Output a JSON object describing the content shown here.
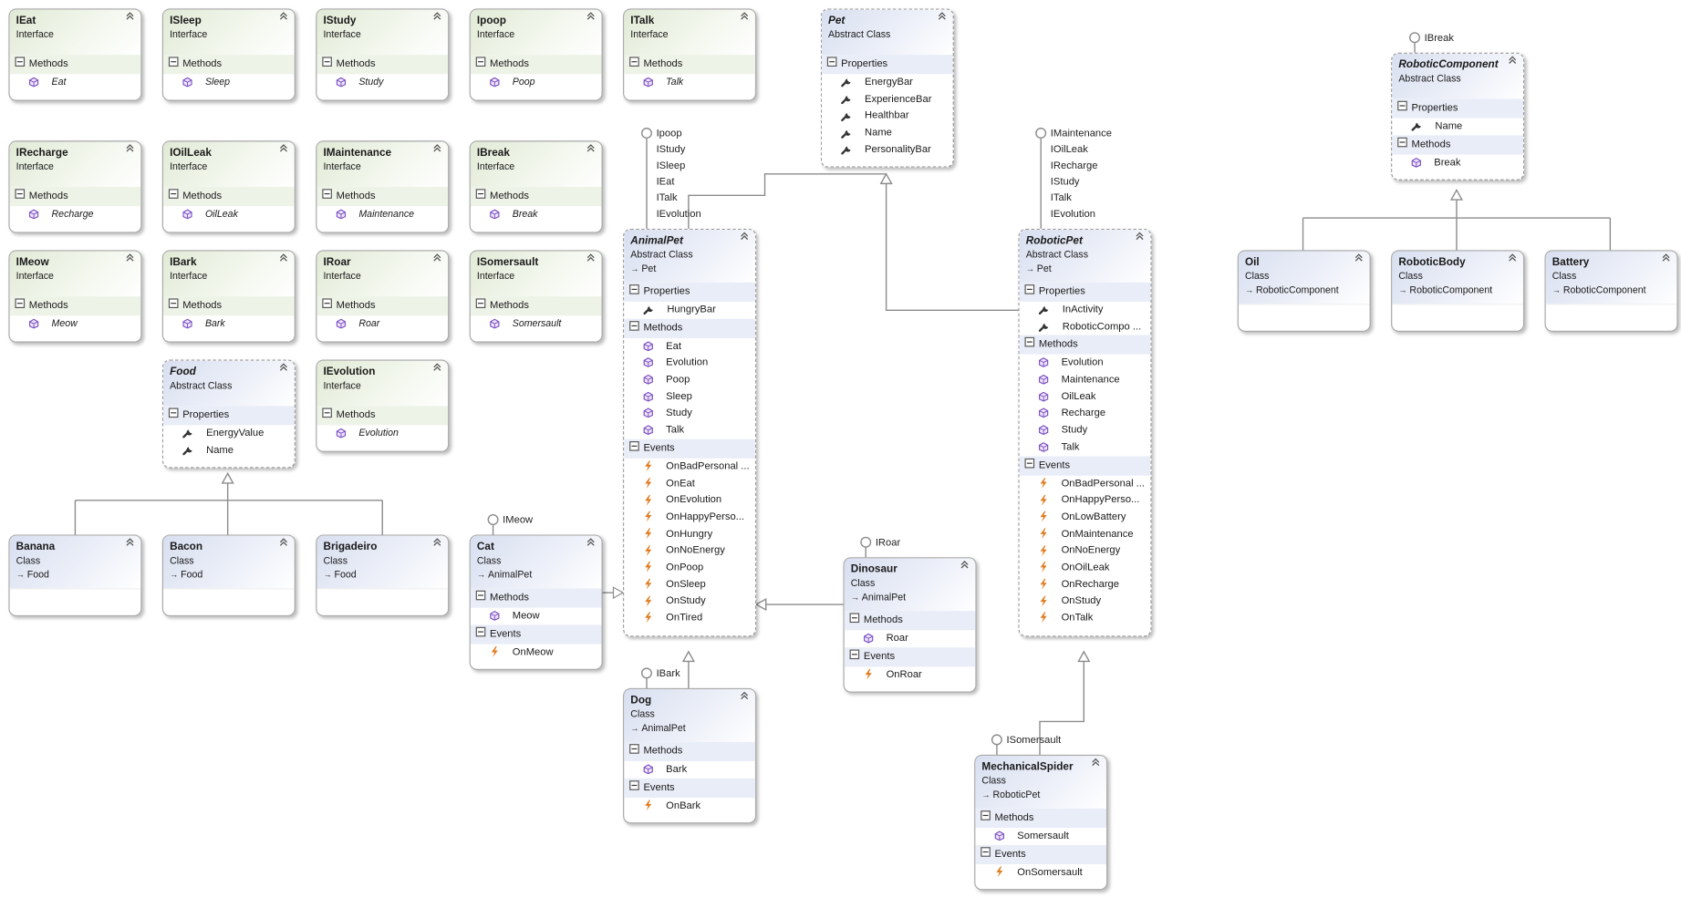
{
  "colors": {
    "interface_header": "#e1ead6",
    "class_header": "#d8dff0",
    "method_icon": "#7b4fc2",
    "event_icon": "#e07b20",
    "connector": "#8c8c8c"
  },
  "icons": {
    "collapse": "double-chevron-up-icon",
    "section_toggle": "minus-box-icon",
    "method": "method-cube-icon",
    "property": "wrench-icon",
    "event": "lightning-icon",
    "lollipop": "interface-lollipop-icon",
    "inheritance": "hollow-triangle-arrow-icon"
  },
  "boxes": [
    {
      "id": "IEat",
      "name": "IEat",
      "kind": "Interface",
      "sections": [
        {
          "label": "Methods",
          "items": [
            {
              "name": "Eat",
              "icon": "method"
            }
          ]
        }
      ]
    },
    {
      "id": "ISleep",
      "name": "ISleep",
      "kind": "Interface",
      "sections": [
        {
          "label": "Methods",
          "items": [
            {
              "name": "Sleep",
              "icon": "method"
            }
          ]
        }
      ]
    },
    {
      "id": "IStudy",
      "name": "IStudy",
      "kind": "Interface",
      "sections": [
        {
          "label": "Methods",
          "items": [
            {
              "name": "Study",
              "icon": "method"
            }
          ]
        }
      ]
    },
    {
      "id": "Ipoop",
      "name": "Ipoop",
      "kind": "Interface",
      "sections": [
        {
          "label": "Methods",
          "items": [
            {
              "name": "Poop",
              "icon": "method"
            }
          ]
        }
      ]
    },
    {
      "id": "ITalk",
      "name": "ITalk",
      "kind": "Interface",
      "sections": [
        {
          "label": "Methods",
          "items": [
            {
              "name": "Talk",
              "icon": "method"
            }
          ]
        }
      ]
    },
    {
      "id": "IRecharge",
      "name": "IRecharge",
      "kind": "Interface",
      "sections": [
        {
          "label": "Methods",
          "items": [
            {
              "name": "Recharge",
              "icon": "method"
            }
          ]
        }
      ]
    },
    {
      "id": "IOilLeak",
      "name": "IOilLeak",
      "kind": "Interface",
      "sections": [
        {
          "label": "Methods",
          "items": [
            {
              "name": "OilLeak",
              "icon": "method"
            }
          ]
        }
      ]
    },
    {
      "id": "IMaintenance",
      "name": "IMaintenance",
      "kind": "Interface",
      "sections": [
        {
          "label": "Methods",
          "items": [
            {
              "name": "Maintenance",
              "icon": "method"
            }
          ]
        }
      ]
    },
    {
      "id": "IBreak",
      "name": "IBreak",
      "kind": "Interface",
      "sections": [
        {
          "label": "Methods",
          "items": [
            {
              "name": "Break",
              "icon": "method"
            }
          ]
        }
      ]
    },
    {
      "id": "IMeow",
      "name": "IMeow",
      "kind": "Interface",
      "sections": [
        {
          "label": "Methods",
          "items": [
            {
              "name": "Meow",
              "icon": "method"
            }
          ]
        }
      ]
    },
    {
      "id": "IBark",
      "name": "IBark",
      "kind": "Interface",
      "sections": [
        {
          "label": "Methods",
          "items": [
            {
              "name": "Bark",
              "icon": "method"
            }
          ]
        }
      ]
    },
    {
      "id": "IRoar",
      "name": "IRoar",
      "kind": "Interface",
      "sections": [
        {
          "label": "Methods",
          "items": [
            {
              "name": "Roar",
              "icon": "method"
            }
          ]
        }
      ]
    },
    {
      "id": "ISomersault",
      "name": "ISomersault",
      "kind": "Interface",
      "sections": [
        {
          "label": "Methods",
          "items": [
            {
              "name": "Somersault",
              "icon": "method"
            }
          ]
        }
      ]
    },
    {
      "id": "IEvolution",
      "name": "IEvolution",
      "kind": "Interface",
      "sections": [
        {
          "label": "Methods",
          "items": [
            {
              "name": "Evolution",
              "icon": "method"
            }
          ]
        }
      ]
    },
    {
      "id": "Food",
      "name": "Food",
      "kind": "Abstract Class",
      "abstract": true,
      "sections": [
        {
          "label": "Properties",
          "items": [
            {
              "name": "EnergyValue",
              "icon": "property"
            },
            {
              "name": "Name",
              "icon": "property"
            }
          ]
        }
      ]
    },
    {
      "id": "Banana",
      "name": "Banana",
      "kind": "Class",
      "base": "Food",
      "sections": []
    },
    {
      "id": "Bacon",
      "name": "Bacon",
      "kind": "Class",
      "base": "Food",
      "sections": []
    },
    {
      "id": "Brigadeiro",
      "name": "Brigadeiro",
      "kind": "Class",
      "base": "Food",
      "sections": []
    },
    {
      "id": "Pet",
      "name": "Pet",
      "kind": "Abstract Class",
      "abstract": true,
      "sections": [
        {
          "label": "Properties",
          "items": [
            {
              "name": "EnergyBar",
              "icon": "property"
            },
            {
              "name": "ExperienceBar",
              "icon": "property"
            },
            {
              "name": "Healthbar",
              "icon": "property"
            },
            {
              "name": "Name",
              "icon": "property"
            },
            {
              "name": "PersonalityBar",
              "icon": "property"
            }
          ]
        }
      ]
    },
    {
      "id": "AnimalPet",
      "name": "AnimalPet",
      "kind": "Abstract Class",
      "abstract": true,
      "base": "Pet",
      "sections": [
        {
          "label": "Properties",
          "items": [
            {
              "name": "HungryBar",
              "icon": "property"
            }
          ]
        },
        {
          "label": "Methods",
          "items": [
            {
              "name": "Eat",
              "icon": "method"
            },
            {
              "name": "Evolution",
              "icon": "method"
            },
            {
              "name": "Poop",
              "icon": "method"
            },
            {
              "name": "Sleep",
              "icon": "method"
            },
            {
              "name": "Study",
              "icon": "method"
            },
            {
              "name": "Talk",
              "icon": "method"
            }
          ]
        },
        {
          "label": "Events",
          "items": [
            {
              "name": "OnBadPersonal ...",
              "icon": "event"
            },
            {
              "name": "OnEat",
              "icon": "event"
            },
            {
              "name": "OnEvolution",
              "icon": "event"
            },
            {
              "name": "OnHappyPerso...",
              "icon": "event"
            },
            {
              "name": "OnHungry",
              "icon": "event"
            },
            {
              "name": "OnNoEnergy",
              "icon": "event"
            },
            {
              "name": "OnPoop",
              "icon": "event"
            },
            {
              "name": "OnSleep",
              "icon": "event"
            },
            {
              "name": "OnStudy",
              "icon": "event"
            },
            {
              "name": "OnTired",
              "icon": "event"
            }
          ]
        }
      ]
    },
    {
      "id": "Cat",
      "name": "Cat",
      "kind": "Class",
      "base": "AnimalPet",
      "sections": [
        {
          "label": "Methods",
          "items": [
            {
              "name": "Meow",
              "icon": "method"
            }
          ]
        },
        {
          "label": "Events",
          "items": [
            {
              "name": "OnMeow",
              "icon": "event"
            }
          ]
        }
      ]
    },
    {
      "id": "Dog",
      "name": "Dog",
      "kind": "Class",
      "base": "AnimalPet",
      "sections": [
        {
          "label": "Methods",
          "items": [
            {
              "name": "Bark",
              "icon": "method"
            }
          ]
        },
        {
          "label": "Events",
          "items": [
            {
              "name": "OnBark",
              "icon": "event"
            }
          ]
        }
      ]
    },
    {
      "id": "Dinosaur",
      "name": "Dinosaur",
      "kind": "Class",
      "base": "AnimalPet",
      "sections": [
        {
          "label": "Methods",
          "items": [
            {
              "name": "Roar",
              "icon": "method"
            }
          ]
        },
        {
          "label": "Events",
          "items": [
            {
              "name": "OnRoar",
              "icon": "event"
            }
          ]
        }
      ]
    },
    {
      "id": "RoboticPet",
      "name": "RoboticPet",
      "kind": "Abstract Class",
      "abstract": true,
      "base": "Pet",
      "sections": [
        {
          "label": "Properties",
          "items": [
            {
              "name": "InActivity",
              "icon": "property"
            },
            {
              "name": "RoboticCompo ...",
              "icon": "property"
            }
          ]
        },
        {
          "label": "Methods",
          "items": [
            {
              "name": "Evolution",
              "icon": "method"
            },
            {
              "name": "Maintenance",
              "icon": "method"
            },
            {
              "name": "OilLeak",
              "icon": "method"
            },
            {
              "name": "Recharge",
              "icon": "method"
            },
            {
              "name": "Study",
              "icon": "method"
            },
            {
              "name": "Talk",
              "icon": "method"
            }
          ]
        },
        {
          "label": "Events",
          "items": [
            {
              "name": "OnBadPersonal ...",
              "icon": "event"
            },
            {
              "name": "OnHappyPerso...",
              "icon": "event"
            },
            {
              "name": "OnLowBattery",
              "icon": "event"
            },
            {
              "name": "OnMaintenance",
              "icon": "event"
            },
            {
              "name": "OnNoEnergy",
              "icon": "event"
            },
            {
              "name": "OnOilLeak",
              "icon": "event"
            },
            {
              "name": "OnRecharge",
              "icon": "event"
            },
            {
              "name": "OnStudy",
              "icon": "event"
            },
            {
              "name": "OnTalk",
              "icon": "event"
            }
          ]
        }
      ]
    },
    {
      "id": "MechanicalSpider",
      "name": "MechanicalSpider",
      "kind": "Class",
      "base": "RoboticPet",
      "sections": [
        {
          "label": "Methods",
          "items": [
            {
              "name": "Somersault",
              "icon": "method"
            }
          ]
        },
        {
          "label": "Events",
          "items": [
            {
              "name": "OnSomersault",
              "icon": "event"
            }
          ]
        }
      ]
    },
    {
      "id": "RoboticComponent",
      "name": "RoboticComponent",
      "kind": "Abstract Class",
      "abstract": true,
      "sections": [
        {
          "label": "Properties",
          "items": [
            {
              "name": "Name",
              "icon": "property"
            }
          ]
        },
        {
          "label": "Methods",
          "items": [
            {
              "name": "Break",
              "icon": "method"
            }
          ]
        }
      ]
    },
    {
      "id": "Oil",
      "name": "Oil",
      "kind": "Class",
      "base": "RoboticComponent",
      "sections": []
    },
    {
      "id": "RoboticBody",
      "name": "RoboticBody",
      "kind": "Class",
      "base": "RoboticComponent",
      "sections": []
    },
    {
      "id": "Battery",
      "name": "Battery",
      "kind": "Class",
      "base": "RoboticComponent",
      "sections": []
    }
  ],
  "lollipops": [
    {
      "id": "animalpet-interfaces",
      "labels": [
        "Ipoop",
        "IStudy",
        "ISleep",
        "IEat",
        "ITalk",
        "IEvolution"
      ]
    },
    {
      "id": "roboticpet-interfaces",
      "labels": [
        "IMaintenance",
        "IOilLeak",
        "IRecharge",
        "IStudy",
        "ITalk",
        "IEvolution"
      ]
    },
    {
      "id": "cat-interfaces",
      "labels": [
        "IMeow"
      ]
    },
    {
      "id": "dog-interfaces",
      "labels": [
        "IBark"
      ]
    },
    {
      "id": "dinosaur-interfaces",
      "labels": [
        "IRoar"
      ]
    },
    {
      "id": "spider-interfaces",
      "labels": [
        "ISomersault"
      ]
    },
    {
      "id": "roboticcomponent-interfaces",
      "labels": [
        "IBreak"
      ]
    }
  ]
}
